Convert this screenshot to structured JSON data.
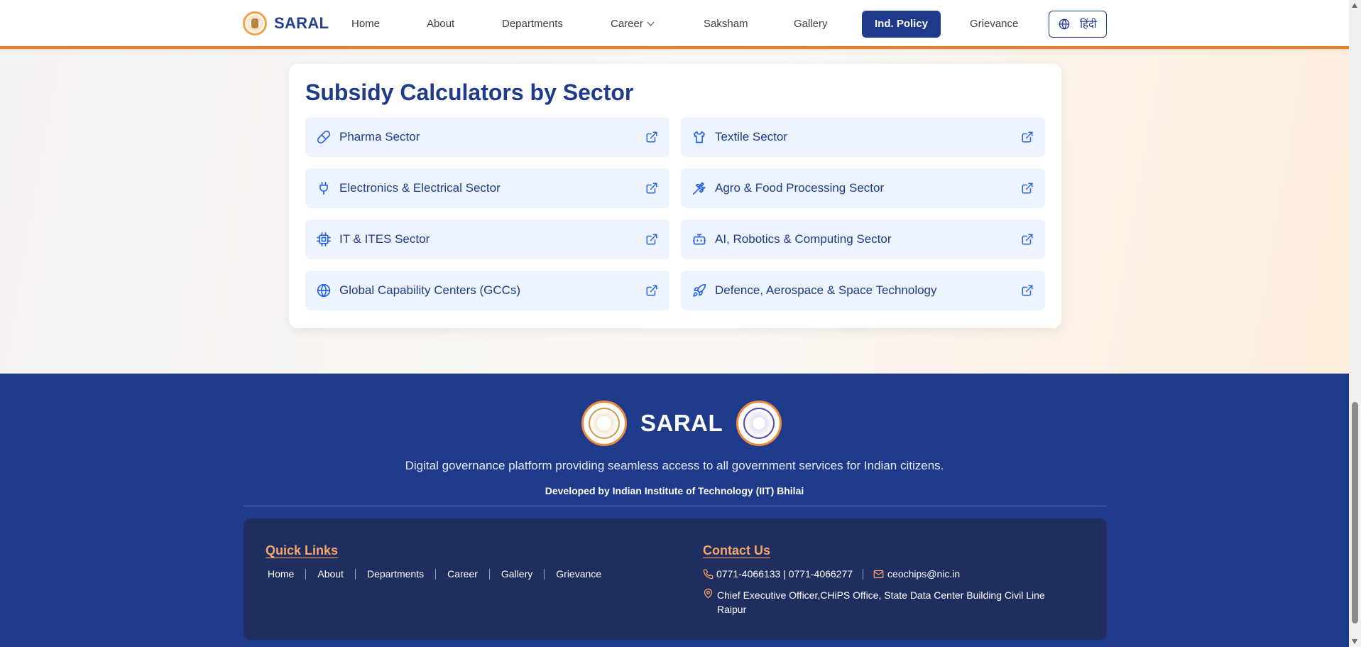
{
  "header": {
    "brand": "SARAL",
    "nav": [
      {
        "label": "Home"
      },
      {
        "label": "About"
      },
      {
        "label": "Departments"
      },
      {
        "label": "Career"
      },
      {
        "label": "Saksham"
      },
      {
        "label": "Gallery"
      },
      {
        "label": "Ind. Policy",
        "active": true
      },
      {
        "label": "Grievance"
      }
    ],
    "language_label": "हिंदी"
  },
  "calculators": {
    "title": "Subsidy Calculators by Sector",
    "sectors": [
      {
        "label": "Pharma Sector",
        "icon": "pill-icon"
      },
      {
        "label": "Textile Sector",
        "icon": "shirt-icon"
      },
      {
        "label": "Electronics & Electrical Sector",
        "icon": "plug-icon"
      },
      {
        "label": "Agro & Food Processing Sector",
        "icon": "wheat-icon"
      },
      {
        "label": "IT & ITES Sector",
        "icon": "chip-icon"
      },
      {
        "label": "AI, Robotics & Computing Sector",
        "icon": "robot-icon"
      },
      {
        "label": "Global Capability Centers (GCCs)",
        "icon": "globe-icon"
      },
      {
        "label": "Defence, Aerospace & Space Technology",
        "icon": "rocket-icon"
      }
    ]
  },
  "footer": {
    "brand": "SARAL",
    "description": "Digital governance platform providing seamless access to all government services for Indian citizens.",
    "developer": "Developed by Indian Institute of Technology (IIT) Bhilai",
    "quick_links_title": "Quick Links",
    "quick_links": [
      "Home",
      "About",
      "Departments",
      "Career",
      "Gallery",
      "Grievance"
    ],
    "contact_title": "Contact Us",
    "phone": "0771-4066133 | 0771-4066277",
    "email": "ceochips@nic.in",
    "address": "Chief Executive Officer,CHiPS Office, State Data Center Building Civil Line",
    "address_line2": "Raipur"
  },
  "colors": {
    "primary": "#1e3a8a",
    "accent": "#f07b22",
    "tile": "#eef4fe",
    "icon": "#2563eb"
  }
}
